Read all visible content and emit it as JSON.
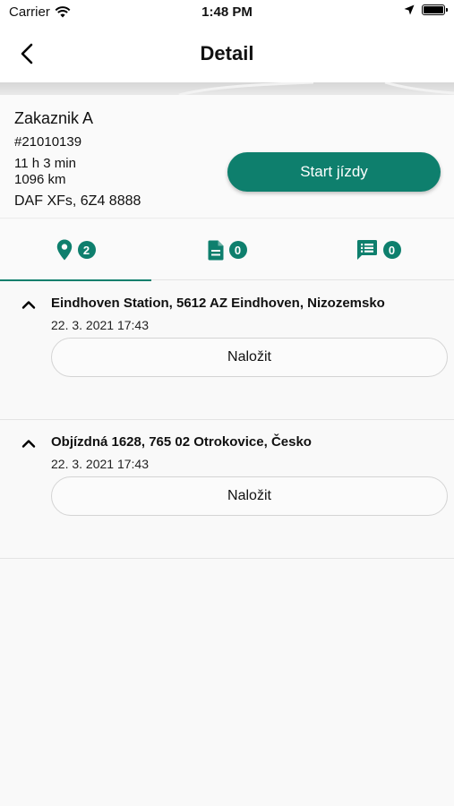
{
  "status_bar": {
    "carrier": "Carrier",
    "time": "1:48 PM"
  },
  "header": {
    "title": "Detail"
  },
  "summary": {
    "customer": "Zakaznik A",
    "order_number": "#21010139",
    "duration": "11 h 3 min",
    "distance": "1096 km",
    "vehicle": "DAF XFs, 6Z4 8888",
    "start_button": "Start jízdy"
  },
  "tabs": [
    {
      "icon": "location-pin-icon",
      "count": "2",
      "active": true
    },
    {
      "icon": "document-icon",
      "count": "0",
      "active": false
    },
    {
      "icon": "message-list-icon",
      "count": "0",
      "active": false
    }
  ],
  "stops": [
    {
      "address": "Eindhoven Station, 5612 AZ Eindhoven, Nizozemsko",
      "datetime": "22. 3. 2021 17:43",
      "action": "Naložit"
    },
    {
      "address": "Objízdná 1628, 765 02 Otrokovice, Česko",
      "datetime": "22. 3. 2021 17:43",
      "action": "Naložit"
    }
  ],
  "colors": {
    "accent": "#0e7f6d",
    "background": "#f9f9f9",
    "divider": "#e4e4e4"
  }
}
